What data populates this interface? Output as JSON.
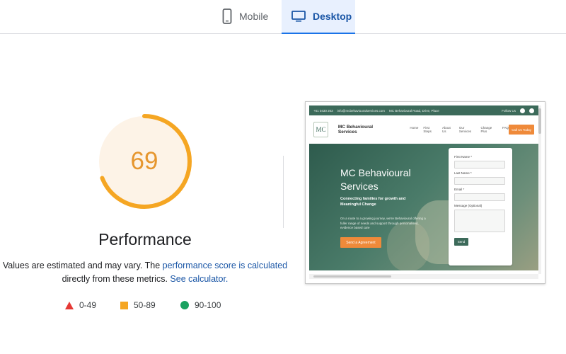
{
  "tabs": [
    {
      "label": "Mobile",
      "icon": "smartphone-icon",
      "selected": false
    },
    {
      "label": "Desktop",
      "icon": "monitor-icon",
      "selected": true
    }
  ],
  "score": {
    "value": "69",
    "fraction": 0.69,
    "color": "#f5a623",
    "bg": "#fdf3e7"
  },
  "performance_title": "Performance",
  "description": {
    "prefix": "Values are estimated and may vary. The ",
    "link1": "performance score is calculated",
    "middle": " directly from these metrics. ",
    "link2": "See calculator."
  },
  "legend": [
    {
      "shape": "triangle",
      "range": "0-49",
      "color": "#e53935"
    },
    {
      "shape": "square",
      "range": "50-89",
      "color": "#f5a623"
    },
    {
      "shape": "circle",
      "range": "90-100",
      "color": "#1aa260"
    }
  ],
  "screenshot": {
    "topbar": {
      "phone": "+61 0430 203",
      "email": "info@mcbehaviouralservices.com",
      "address": "MC Behavioural Road, Drive, Place",
      "follow": "Follow Us"
    },
    "logo": "MC",
    "brand": "MC Behavioural Services",
    "nav": [
      "Home",
      "First Steps",
      "About Us",
      "Our Services",
      "Change Plus",
      "FAQ"
    ],
    "cta": "Call Us Today",
    "hero_title": "MC Behavioural Services",
    "hero_subtitle": "Connecting families for growth and Meaningful Change",
    "hero_body": "On a route to a growing journey, we're Behavioural offering a fuller range of needs and support through personalised, evidence based care",
    "hero_button": "Send a Agreement",
    "form": {
      "first_name": "First Name *",
      "last_name": "Last Name *",
      "email": "Email *",
      "message": "Message (Optional)",
      "send": "Send"
    }
  }
}
